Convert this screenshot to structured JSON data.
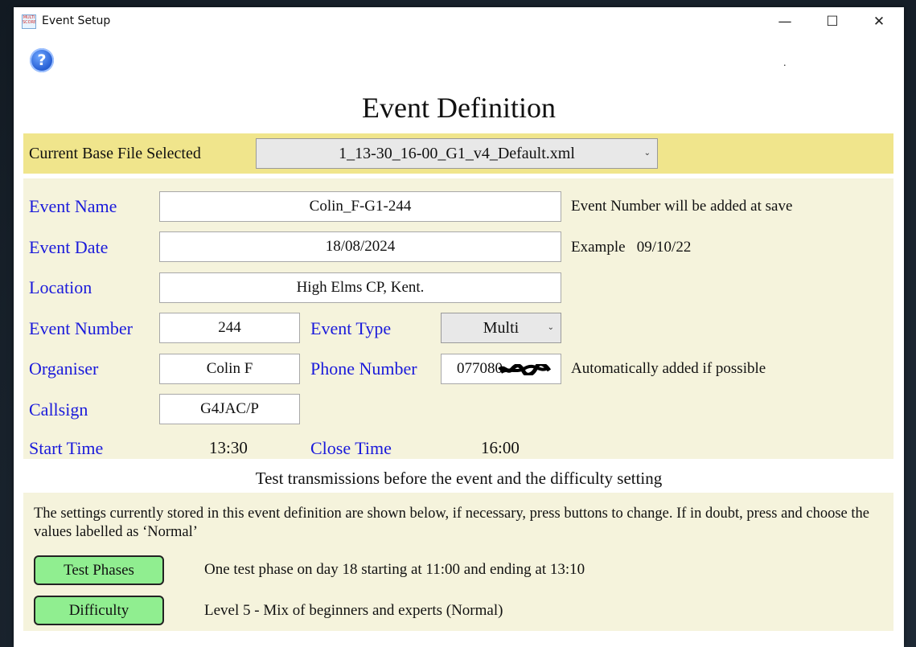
{
  "window": {
    "title": "Event Setup",
    "app_icon_text": "MULTI SCORE",
    "minimize_glyph": "—",
    "maximize_glyph": "☐",
    "close_glyph": "✕"
  },
  "help": {
    "glyph": "?",
    "icon": "help-icon"
  },
  "stray_dot": ".",
  "page_title": "Event Definition",
  "base_file": {
    "label": "Current Base File Selected",
    "selected": "1_13-30_16-00_G1_v4_Default.xml"
  },
  "form": {
    "event_name": {
      "label": "Event Name",
      "value": "Colin_F-G1-244",
      "note": "Event Number will be added at save"
    },
    "event_date": {
      "label": "Event Date",
      "value": "18/08/2024",
      "note": "Example   09/10/22"
    },
    "location": {
      "label": "Location",
      "value": "High Elms CP, Kent."
    },
    "event_number": {
      "label": "Event Number",
      "value": "244"
    },
    "event_type": {
      "label": "Event Type",
      "selected": "Multi"
    },
    "organiser": {
      "label": "Organiser",
      "value": "Colin F"
    },
    "phone_number": {
      "label": "Phone Number",
      "value": "077080",
      "note": "Automatically added if possible"
    },
    "callsign": {
      "label": "Callsign",
      "value": "G4JAC/P"
    },
    "start_time": {
      "label": "Start Time",
      "value": "13:30"
    },
    "close_time": {
      "label": "Close Time",
      "value": "16:00"
    }
  },
  "test_section": {
    "heading": "Test transmissions before the event and the difficulty setting",
    "description": "The settings currently stored in this event definition are shown below, if necessary, press buttons to change. If in doubt, press and choose the values labelled as ‘Normal’",
    "test_phases": {
      "button": "Test Phases",
      "text": "One test phase on day 18 starting at 11:00 and ending at 13:10"
    },
    "difficulty": {
      "button": "Difficulty",
      "text": "Level 5 - Mix of beginners and experts (Normal)"
    }
  },
  "colors": {
    "label_blue": "#1a1adb",
    "base_bar": "#f0e58c",
    "panel": "#f5f3dc",
    "button_green": "#90ee90"
  }
}
